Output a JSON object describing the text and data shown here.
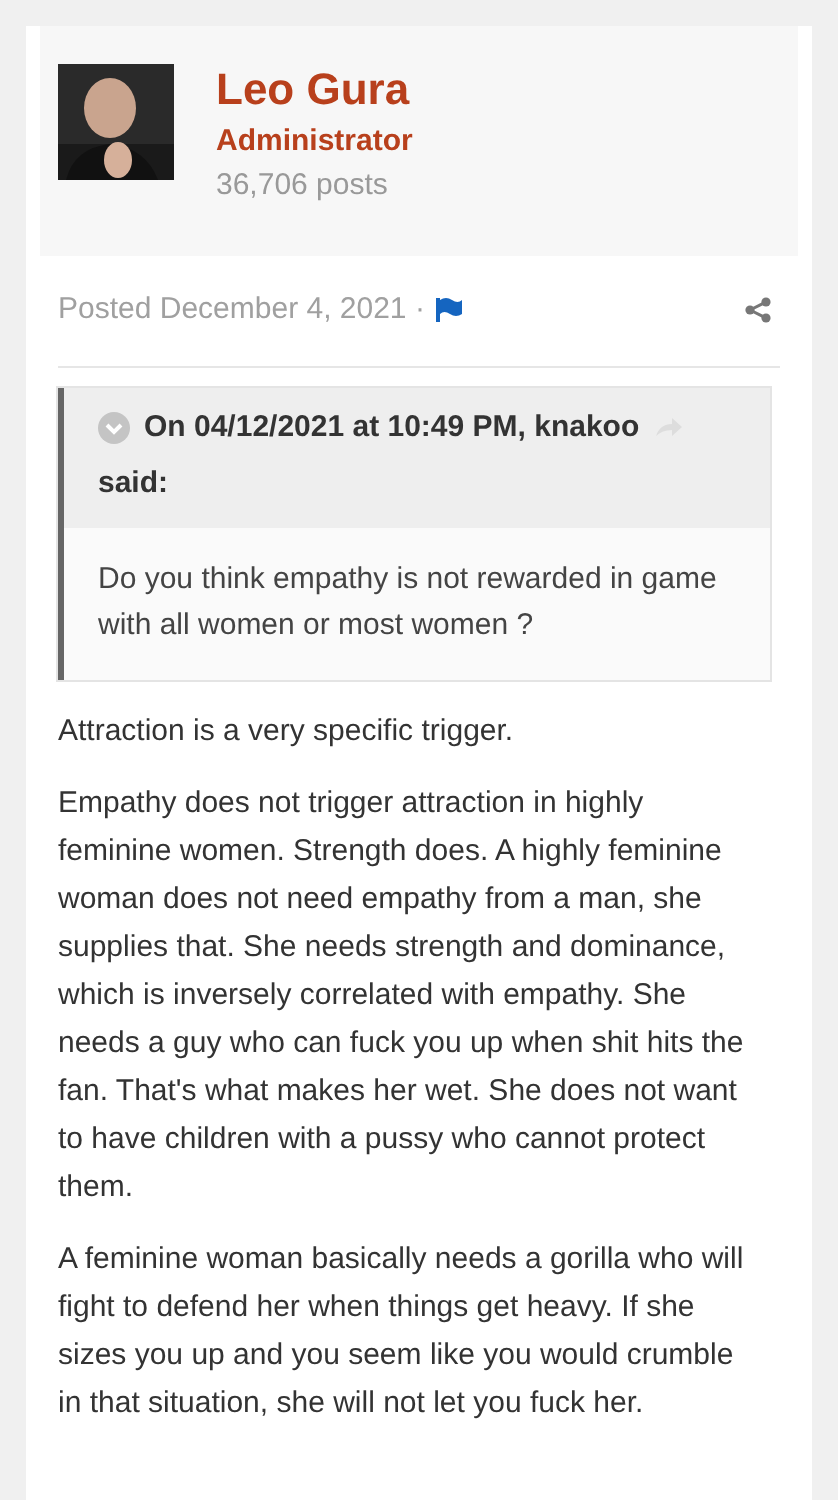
{
  "author": {
    "name": "Leo Gura",
    "role": "Administrator",
    "posts": "36,706 posts"
  },
  "post_meta": {
    "posted": "Posted December 4, 2021 ·"
  },
  "quote": {
    "citation": "On 04/12/2021 at 10:49 PM, knakoo",
    "said": "said:",
    "text": "Do you think empathy is not rewarded in game with all women or most women ?"
  },
  "paragraphs": [
    "Attraction is a very specific trigger.",
    "Empathy does not trigger attraction in highly feminine women. Strength does. A highly feminine woman does not need empathy from a man, she supplies that. She needs strength and dominance, which is inversely correlated with empathy. She needs a guy who can fuck you up when shit hits the fan. That's what makes her wet. She does not want to have children with a pussy who cannot protect them.",
    "A feminine woman basically needs a gorilla who will fight to defend her when things get heavy. If she sizes you up and you seem like you would crumble in that situation, she will not let you fuck her."
  ]
}
